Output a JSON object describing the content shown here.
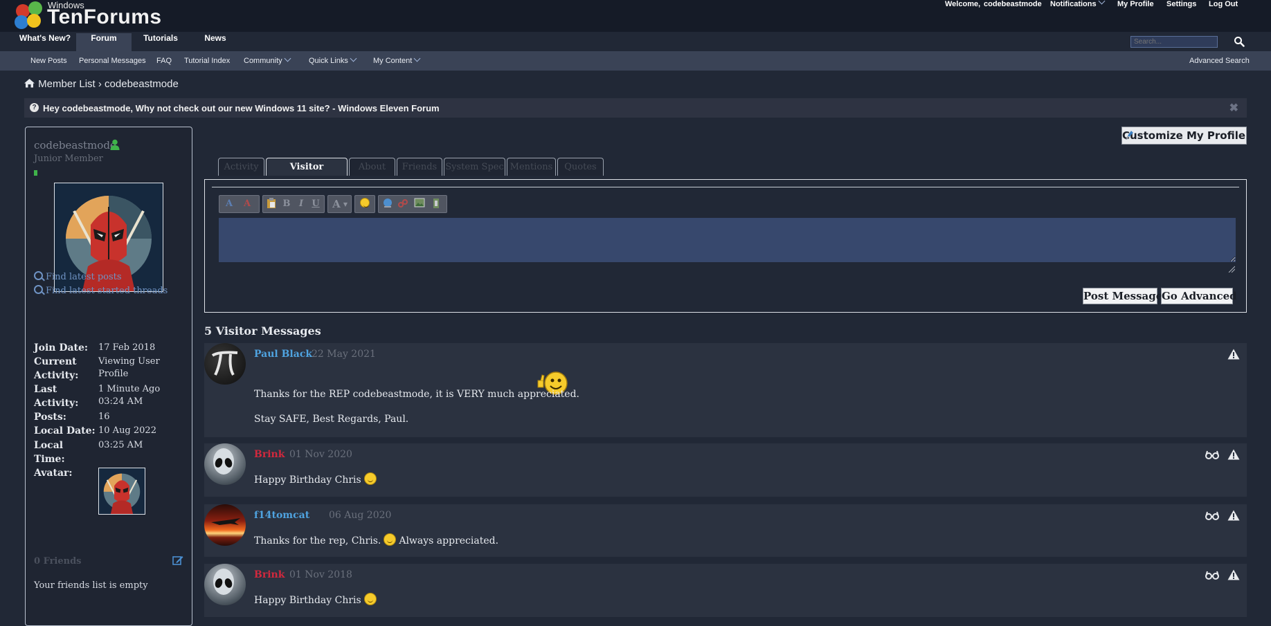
{
  "header": {
    "logo_small": "Windows",
    "logo_big": "TenForums",
    "user_nav": {
      "welcome": "Welcome,",
      "username": "codebeastmode",
      "notifications": "Notifications",
      "my_profile": "My Profile",
      "settings": "Settings",
      "logout": "Log Out"
    },
    "main_nav": [
      "What's New?",
      "Forum",
      "Tutorials",
      "News"
    ],
    "search_placeholder": "Search...",
    "sub_nav": {
      "new_posts": "New Posts",
      "personal_messages": "Personal Messages",
      "faq": "FAQ",
      "tutorial_index": "Tutorial Index",
      "community": "Community",
      "quick_links": "Quick Links",
      "my_content": "My Content",
      "advanced_search": "Advanced Search"
    }
  },
  "breadcrumb": {
    "home_icon": "home-icon",
    "item1": "Member List",
    "separator": "›",
    "item2": "codebeastmode"
  },
  "notice": {
    "icon": "?",
    "text": "Hey codebeastmode, Why not check out our new Windows 11 site? - Windows Eleven Forum",
    "close": "✖"
  },
  "sidebar": {
    "username": "codebeastmode",
    "title": "Junior Member",
    "links": [
      "Find latest posts",
      "Find latest started threads"
    ],
    "stats": {
      "join_date_label": "Join Date:",
      "join_date": "17 Feb 2018",
      "current_activity_label1": "Current",
      "current_activity_label2": "Activity:",
      "current_activity1": "Viewing User",
      "current_activity2": "Profile",
      "last_activity_label1": "Last",
      "last_activity_label2": "Activity:",
      "last_activity1": "1 Minute Ago",
      "last_activity2": "03:24 AM",
      "posts_label": "Posts:",
      "posts": "16",
      "local_date_label": "Local Date:",
      "local_date": "10 Aug 2022",
      "local_time_label1": "Local",
      "local_time_label2": "Time:",
      "local_time": "03:25 AM",
      "avatar_label": "Avatar:"
    },
    "friends_heading": "0 Friends",
    "friends_empty": "Your friends list is empty"
  },
  "profile": {
    "customize_label": "Customize My Profile",
    "tabs": [
      "Activity",
      "Visitor Messages",
      "About",
      "Friends",
      "System Spec",
      "Mentions",
      "Quotes"
    ],
    "active_tab": "Visitor Messages"
  },
  "editor": {
    "toolbar": [
      "A",
      "B",
      "I",
      "U",
      "A"
    ],
    "post_label": "Post Message",
    "advanced_label": "Go Advanced"
  },
  "visitor_messages": {
    "heading": "5 Visitor Messages",
    "items": [
      {
        "author": "Paul Black",
        "date": "22 May 2021",
        "line1": "Thanks for the REP codebeastmode, it is VERY much appreciated.",
        "line2": "Stay SAFE, Best Regards, Paul."
      },
      {
        "author": "Brink",
        "date": "01 Nov 2020",
        "line1": "Happy Birthday Chris"
      },
      {
        "author": "f14tomcat",
        "date": "06 Aug 2020",
        "line1": "Thanks for the rep, Chris.",
        "line1b": "Always appreciated."
      },
      {
        "author": "Brink",
        "date": "01 Nov 2018",
        "line1": "Happy Birthday Chris"
      }
    ]
  },
  "colors": {
    "page_bg": "#212836",
    "header_bg": "#151b27",
    "subnav_bg": "#3a4356",
    "message_bg": "#2b3240",
    "link_blue": "#4fa3e0",
    "admin_red": "#d2283d"
  }
}
